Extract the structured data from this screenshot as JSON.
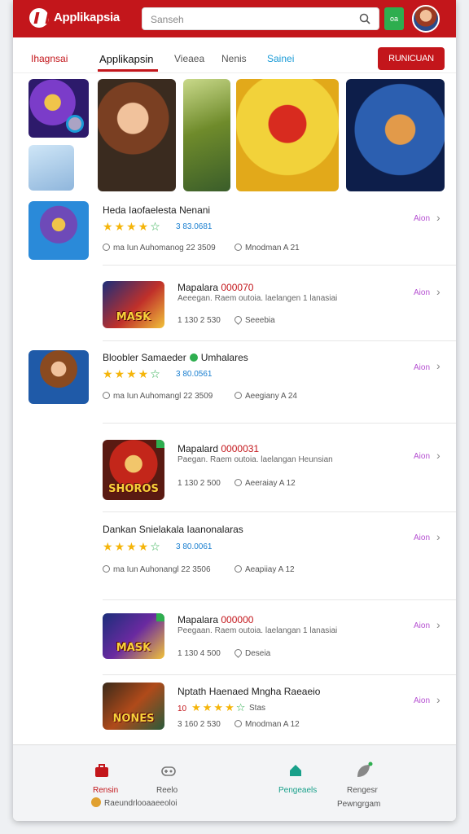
{
  "header": {
    "app_name": "Applikapsia",
    "search_placeholder": "Sanseh",
    "green_button": "oa",
    "colors": {
      "brand": "#c3161b",
      "accent_green": "#2eae4f",
      "link_blue": "#1a9bd7"
    }
  },
  "tabs": [
    {
      "label": "Ihagnsai"
    },
    {
      "label": "Applikapsin"
    },
    {
      "label": "Vieaea"
    },
    {
      "label": "Nenis"
    },
    {
      "label": "Sainei"
    }
  ],
  "cta_label": "RUNICUAN",
  "featured": {
    "thumbs": [
      {
        "icon": "hero-game-art"
      },
      {
        "icon": "cannon-game-art"
      },
      {
        "icon": "warrior-game-art"
      },
      {
        "icon": "tank-game-art"
      },
      {
        "icon": "kart-game-art"
      },
      {
        "icon": "space-game-art"
      }
    ]
  },
  "list": [
    {
      "title": "Heda Iaofaelesta Nenani",
      "stars": "★★★★",
      "star_half": "☆",
      "rating": "3 83.0681",
      "meta_left": "ma Iun Auhomanog 22 3509",
      "meta_right": "Mnodman A 21",
      "link": "Aion"
    },
    {
      "title_a": "Mapalara",
      "title_b": "000070",
      "desc": "Aeeegan. Raem outoia. laelangen 1 lanasiai",
      "meta_left": "1 130 2 530",
      "meta_right": "Seeebia",
      "link": "Aion",
      "thumb_label": "MASK"
    },
    {
      "title": "Bloobler Samaeder",
      "title_suffix": "Umhalares",
      "stars": "★★★★",
      "star_half": "☆",
      "rating": "3 80.0561",
      "meta_left": "ma Iun Auhomangl 22 3509",
      "meta_right": "Aeegiany A 24",
      "link": "Aion"
    },
    {
      "title_a": "Mapalard",
      "title_b": "0000031",
      "desc": "Paegan. Raem outoia. laelangan Heunsian",
      "meta_left": "1 130 2 500",
      "meta_right": "Aeeraiay A 12",
      "link": "Aion",
      "thumb_label": "SHOROS"
    },
    {
      "title": "Dankan Snielakala Iaanonalaras",
      "stars": "★★★★",
      "star_half": "☆",
      "rating": "3 80.0061",
      "meta_left": "ma Iun Auhonangl 22 3506",
      "meta_right": "Aeapiiay A 12",
      "link": "Aion"
    },
    {
      "title_a": "Mapalara",
      "title_b": "000000",
      "desc": "Peegaan. Raem outoia. laelangan 1 lanasiai",
      "meta_left": "1 130 4 500",
      "meta_right": "Deseia",
      "link": "Aion",
      "thumb_label": "MASK"
    },
    {
      "title": "Nptath Haenaed Mngha Raeaeio",
      "rating_prefix": "10",
      "stars": "★★★★",
      "star_half": "☆",
      "rating_suffix": "Stas",
      "meta_left": "3 160 2 530",
      "meta_right": "Mnodman A 12",
      "link": "Aion",
      "thumb_label": "NONES"
    }
  ],
  "bottom_nav": {
    "items": [
      {
        "label": "Rensin"
      },
      {
        "label": "Reelo"
      },
      {
        "label": "Pengeaels"
      },
      {
        "label": "Rengesr"
      }
    ],
    "footer_left": "Raeundrlooaaeeoloi",
    "footer_right": "Pewngrgam"
  }
}
